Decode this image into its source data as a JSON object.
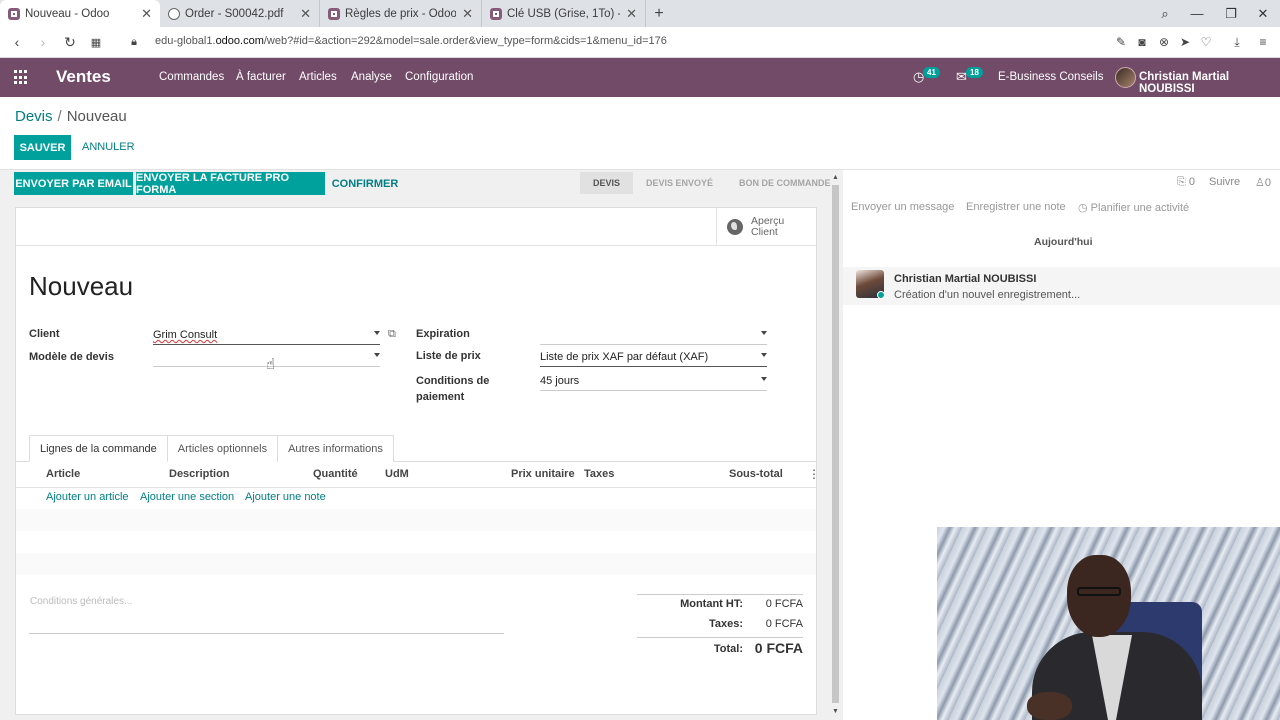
{
  "browser": {
    "tabs": [
      {
        "label": "Nouveau - Odoo",
        "active": true,
        "icon": "odoo-icon"
      },
      {
        "label": "Order - S00042.pdf",
        "active": false,
        "icon": "globe-icon"
      },
      {
        "label": "Règles de prix - Odoo",
        "active": false,
        "icon": "odoo-icon"
      },
      {
        "label": "Clé USB (Grise, 1To) - Odoo",
        "active": false,
        "icon": "odoo-icon"
      }
    ],
    "url_prefix": "edu-global1.",
    "url_domain": "odoo.com",
    "url_rest": "/web?#id=&action=292&model=sale.order&view_type=form&cids=1&menu_id=176"
  },
  "navbar": {
    "app_name": "Ventes",
    "menu": [
      "Commandes",
      "À facturer",
      "Articles",
      "Analyse",
      "Configuration"
    ],
    "activity_count": "41",
    "message_count": "18",
    "company": "E-Business Conseils",
    "user": "Christian Martial NOUBISSI"
  },
  "control_panel": {
    "breadcrumb_parent": "Devis",
    "breadcrumb_sep": "/",
    "breadcrumb_current": "Nouveau",
    "save_label": "SAUVER",
    "discard_label": "ANNULER"
  },
  "statusbar": {
    "buttons": [
      "ENVOYER PAR EMAIL",
      "ENVOYER LA FACTURE PRO FORMA",
      "CONFIRMER"
    ],
    "stages": [
      "DEVIS",
      "DEVIS ENVOYÉ",
      "BON DE COMMANDE"
    ],
    "active_stage": "DEVIS"
  },
  "form": {
    "preview_line1": "Aperçu",
    "preview_line2": "Client",
    "title": "Nouveau",
    "client_label": "Client",
    "client_value": "Grim Consult",
    "template_label": "Modèle de devis",
    "template_value": "",
    "expiration_label": "Expiration",
    "expiration_value": "",
    "pricelist_label": "Liste de prix",
    "pricelist_value": "Liste de prix XAF par défaut (XAF)",
    "payment_terms_label_1": "Conditions de",
    "payment_terms_label_2": "paiement",
    "payment_terms_value": "45 jours"
  },
  "notebook": {
    "tabs": [
      "Lignes de la commande",
      "Articles optionnels",
      "Autres informations"
    ],
    "active_tab": "Lignes de la commande",
    "columns": [
      "Article",
      "Description",
      "Quantité",
      "UdM",
      "Prix unitaire",
      "Taxes",
      "Sous-total"
    ],
    "add_links": [
      "Ajouter un article",
      "Ajouter une section",
      "Ajouter une note"
    ]
  },
  "footer": {
    "terms_placeholder": "Conditions générales...",
    "untaxed_label": "Montant HT:",
    "untaxed_value": "0 FCFA",
    "taxes_label": "Taxes:",
    "taxes_value": "0 FCFA",
    "total_label": "Total:",
    "total_value": "0 FCFA"
  },
  "chatter": {
    "attachments": "0",
    "follow_label": "Suivre",
    "followers": "0",
    "send_message": "Envoyer un message",
    "log_note": "Enregistrer une note",
    "schedule_activity": "Planifier une activité",
    "date_separator": "Aujourd'hui",
    "message_author": "Christian Martial NOUBISSI",
    "message_body": "Création d'un nouvel enregistrement..."
  },
  "colors": {
    "brand": "#714b67",
    "primary": "#00a09d",
    "link": "#017e84"
  }
}
